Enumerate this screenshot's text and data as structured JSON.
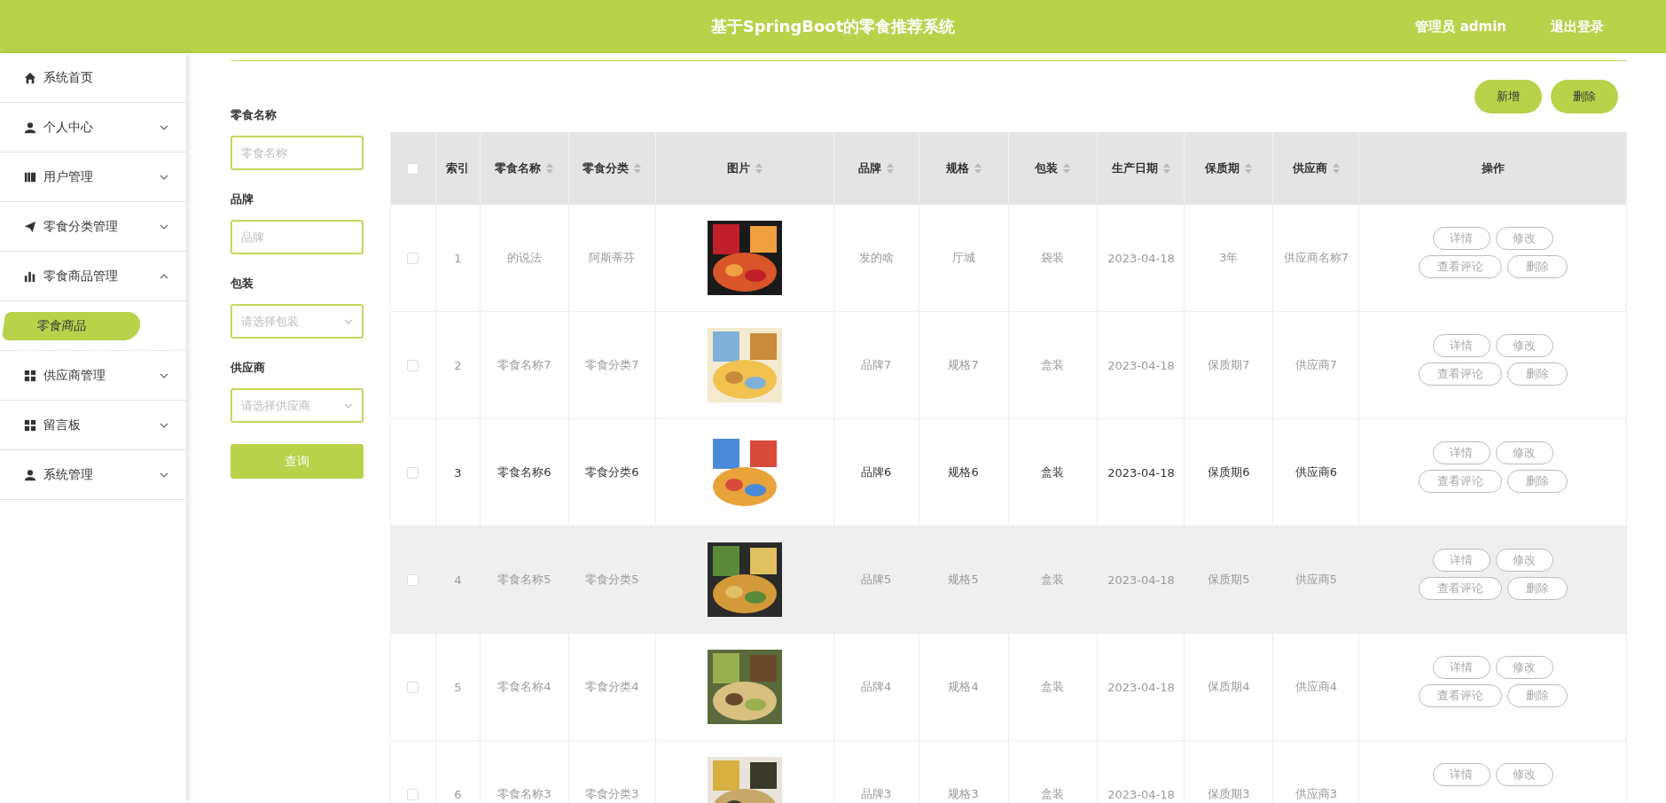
{
  "header": {
    "title": "基于SpringBoot的零食推荐系统",
    "user": "管理员 admin",
    "logout": "退出登录"
  },
  "sidebar": {
    "items": [
      {
        "label": "系统首页"
      },
      {
        "label": "个人中心",
        "expanded": false
      },
      {
        "label": "用户管理",
        "expanded": false
      },
      {
        "label": "零食分类管理",
        "expanded": false
      },
      {
        "label": "零食商品管理",
        "expanded": true,
        "children": [
          {
            "label": "零食商品",
            "selected": true
          }
        ]
      },
      {
        "label": "供应商管理",
        "expanded": false
      },
      {
        "label": "留言板",
        "expanded": false
      },
      {
        "label": "系统管理",
        "expanded": false
      }
    ]
  },
  "filters": [
    {
      "kind": "input",
      "label": "零食名称",
      "placeholder": "零食名称"
    },
    {
      "kind": "input",
      "label": "品牌",
      "placeholder": "品牌"
    },
    {
      "kind": "select",
      "label": "包装",
      "placeholder": "请选择包装"
    },
    {
      "kind": "select",
      "label": "供应商",
      "placeholder": "请选择供应商"
    }
  ],
  "query_button": "查询",
  "toolbar": [
    "新增",
    "删除"
  ],
  "table": {
    "select_all": {
      "checked": false
    },
    "columns": [
      {
        "label": "索引",
        "sortable": false
      },
      {
        "label": "零食名称",
        "sortable": true
      },
      {
        "label": "零食分类",
        "sortable": true
      },
      {
        "label": "图片",
        "sortable": true
      },
      {
        "label": "品牌",
        "sortable": true
      },
      {
        "label": "规格",
        "sortable": true
      },
      {
        "label": "包装",
        "sortable": true
      },
      {
        "label": "生产日期",
        "sortable": true
      },
      {
        "label": "保质期",
        "sortable": true
      },
      {
        "label": "供应商",
        "sortable": true
      },
      {
        "label": "操作",
        "sortable": false
      }
    ],
    "rows": [
      {
        "checked": false,
        "hovered": false,
        "shaded": false,
        "cells": [
          "1",
          "的说法",
          "阿斯蒂芬",
          "",
          "发的啥",
          "厅城",
          "袋装",
          "2023-04-18",
          "3年",
          "供应商名称7"
        ],
        "actions": [
          "详情",
          "修改",
          "查看评论",
          "删除"
        ]
      },
      {
        "checked": false,
        "hovered": false,
        "shaded": false,
        "cells": [
          "2",
          "零食名称7",
          "零食分类7",
          "",
          "品牌7",
          "规格7",
          "盒装",
          "2023-04-18",
          "保质期7",
          "供应商7"
        ],
        "actions": [
          "详情",
          "修改",
          "查看评论",
          "删除"
        ]
      },
      {
        "checked": false,
        "hovered": true,
        "shaded": false,
        "cells": [
          "3",
          "零食名称6",
          "零食分类6",
          "",
          "品牌6",
          "规格6",
          "盒装",
          "2023-04-18",
          "保质期6",
          "供应商6"
        ],
        "actions": [
          "详情",
          "修改",
          "查看评论",
          "删除"
        ]
      },
      {
        "checked": false,
        "hovered": false,
        "shaded": true,
        "cells": [
          "4",
          "零食名称5",
          "零食分类5",
          "",
          "品牌5",
          "规格5",
          "盒装",
          "2023-04-18",
          "保质期5",
          "供应商5"
        ],
        "actions": [
          "详情",
          "修改",
          "查看评论",
          "删除"
        ]
      },
      {
        "checked": false,
        "hovered": false,
        "shaded": false,
        "cells": [
          "5",
          "零食名称4",
          "零食分类4",
          "",
          "品牌4",
          "规格4",
          "盒装",
          "2023-04-18",
          "保质期4",
          "供应商4"
        ],
        "actions": [
          "详情",
          "修改",
          "查看评论",
          "删除"
        ]
      },
      {
        "checked": false,
        "hovered": false,
        "shaded": false,
        "cells": [
          "6",
          "零食名称3",
          "零食分类3",
          "",
          "品牌3",
          "规格3",
          "盒装",
          "2023-04-18",
          "保质期3",
          "供应商3"
        ],
        "actions": [
          "详情",
          "修改"
        ]
      }
    ]
  }
}
